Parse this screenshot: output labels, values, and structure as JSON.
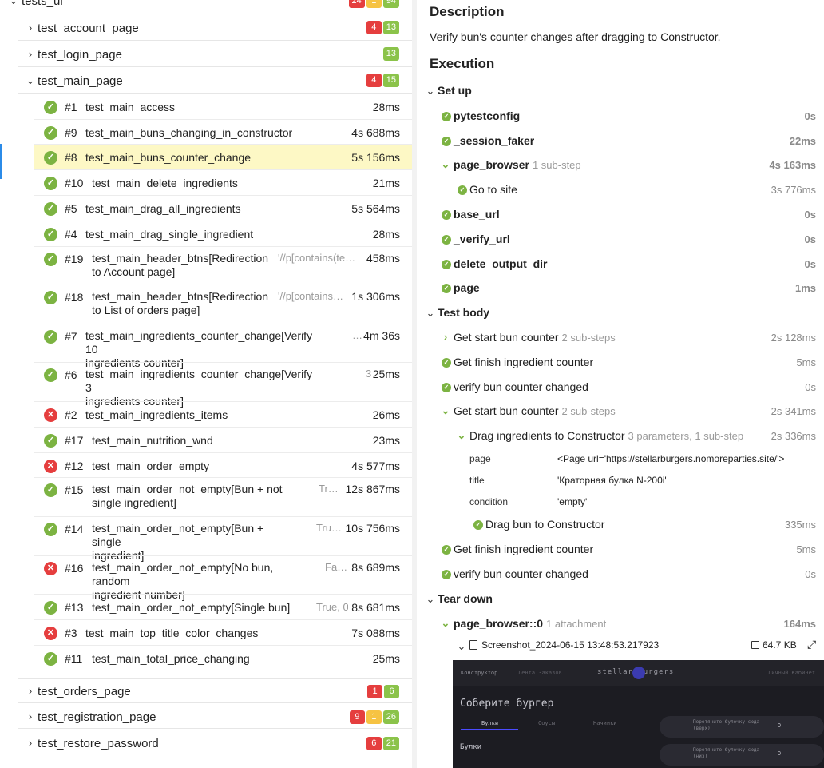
{
  "tree": {
    "root": {
      "label": "tests_ui",
      "badges": [
        "24",
        "1",
        "94"
      ]
    },
    "groups_top": [
      {
        "label": "test_account_page",
        "badges": [
          {
            "v": "4",
            "c": "red"
          },
          {
            "v": "13",
            "c": "grn"
          }
        ]
      },
      {
        "label": "test_login_page",
        "badges": [
          {
            "v": "13",
            "c": "grn"
          }
        ]
      },
      {
        "label": "test_main_page",
        "badges": [
          {
            "v": "4",
            "c": "red"
          },
          {
            "v": "15",
            "c": "grn"
          }
        ]
      }
    ],
    "tests": [
      {
        "num": "#1",
        "name": "test_main_access",
        "name2": "",
        "param": "",
        "dur": "28ms",
        "status": "ok"
      },
      {
        "num": "#9",
        "name": "test_main_buns_changing_in_constructor",
        "name2": "",
        "param": "",
        "dur": "4s 688ms",
        "status": "ok"
      },
      {
        "num": "#8",
        "name": "test_main_buns_counter_change",
        "name2": "",
        "param": "",
        "dur": "5s 156ms",
        "status": "ok"
      },
      {
        "num": "#10",
        "name": "test_main_delete_ingredients",
        "name2": "",
        "param": "",
        "dur": "21ms",
        "status": "ok"
      },
      {
        "num": "#5",
        "name": "test_main_drag_all_ingredients",
        "name2": "",
        "param": "",
        "dur": "5s 564ms",
        "status": "ok"
      },
      {
        "num": "#4",
        "name": "test_main_drag_single_ingredient",
        "name2": "",
        "param": "",
        "dur": "28ms",
        "status": "ok"
      },
      {
        "num": "#19",
        "name": "test_main_header_btns[Redirection",
        "name2": "to Account page]",
        "param": "'//p[contains(te…",
        "dur": "458ms",
        "status": "ok"
      },
      {
        "num": "#18",
        "name": "test_main_header_btns[Redirection",
        "name2": "to List of orders page]",
        "param": "'//p[contains…",
        "dur": "1s 306ms",
        "status": "ok"
      },
      {
        "num": "#7",
        "name": "test_main_ingredients_counter_change[Verify 10",
        "name2": "ingredients counter]",
        "param": "…",
        "dur": "4m 36s",
        "status": "ok"
      },
      {
        "num": "#6",
        "name": "test_main_ingredients_counter_change[Verify 3",
        "name2": "ingredients counter]",
        "param": "3",
        "dur": "25ms",
        "status": "ok"
      },
      {
        "num": "#2",
        "name": "test_main_ingredients_items",
        "name2": "",
        "param": "",
        "dur": "26ms",
        "status": "bad"
      },
      {
        "num": "#17",
        "name": "test_main_nutrition_wnd",
        "name2": "",
        "param": "",
        "dur": "23ms",
        "status": "ok"
      },
      {
        "num": "#12",
        "name": "test_main_order_empty",
        "name2": "",
        "param": "",
        "dur": "4s 577ms",
        "status": "bad"
      },
      {
        "num": "#15",
        "name": "test_main_order_not_empty[Bun + not",
        "name2": "single ingredient]",
        "param": "Tr…",
        "dur": "12s 867ms",
        "status": "ok"
      },
      {
        "num": "#14",
        "name": "test_main_order_not_empty[Bun + single",
        "name2": "ingredient]",
        "param": "Tru…",
        "dur": "10s 756ms",
        "status": "ok"
      },
      {
        "num": "#16",
        "name": "test_main_order_not_empty[No bun, random",
        "name2": "ingredient number]",
        "param": "Fa…",
        "dur": "8s 689ms",
        "status": "bad"
      },
      {
        "num": "#13",
        "name": "test_main_order_not_empty[Single bun]",
        "name2": "",
        "param": "True, 0",
        "dur": "8s 681ms",
        "status": "ok"
      },
      {
        "num": "#3",
        "name": "test_main_top_title_color_changes",
        "name2": "",
        "param": "",
        "dur": "7s 088ms",
        "status": "bad"
      },
      {
        "num": "#11",
        "name": "test_main_total_price_changing",
        "name2": "",
        "param": "",
        "dur": "25ms",
        "status": "ok"
      }
    ],
    "groups_bottom": [
      {
        "label": "test_orders_page",
        "badges": [
          {
            "v": "1",
            "c": "red"
          },
          {
            "v": "6",
            "c": "grn"
          }
        ]
      },
      {
        "label": "test_registration_page",
        "badges": [
          {
            "v": "9",
            "c": "red"
          },
          {
            "v": "1",
            "c": "yel"
          },
          {
            "v": "26",
            "c": "grn"
          }
        ]
      },
      {
        "label": "test_restore_password",
        "badges": [
          {
            "v": "6",
            "c": "red"
          },
          {
            "v": "21",
            "c": "grn"
          }
        ]
      }
    ]
  },
  "detail": {
    "description_title": "Description",
    "description": "Verify bun's counter changes after dragging to Constructor.",
    "execution_title": "Execution",
    "setup": {
      "title": "Set up",
      "steps": [
        {
          "name": "pytestconfig",
          "sub": "",
          "dur": "0s"
        },
        {
          "name": "_session_faker",
          "sub": "",
          "dur": "22ms"
        },
        {
          "name": "page_browser",
          "sub": "1 sub-step",
          "dur": "4s 163ms",
          "child": {
            "name": "Go to site",
            "dur": "3s 776ms"
          }
        },
        {
          "name": "base_url",
          "sub": "",
          "dur": "0s"
        },
        {
          "name": "_verify_url",
          "sub": "",
          "dur": "0s"
        },
        {
          "name": "delete_output_dir",
          "sub": "",
          "dur": "0s"
        },
        {
          "name": "page",
          "sub": "",
          "dur": "1ms"
        }
      ]
    },
    "body": {
      "title": "Test body",
      "steps": [
        {
          "name": "Get start bun counter",
          "sub": "2 sub-steps",
          "dur": "2s 128ms"
        },
        {
          "name": "Get finish ingredient counter",
          "sub": "",
          "dur": "5ms"
        },
        {
          "name": "verify bun counter changed",
          "sub": "",
          "dur": "0s"
        },
        {
          "name": "Get start bun counter",
          "sub": "2 sub-steps",
          "dur": "2s 341ms"
        },
        {
          "name": "Drag ingredients to Constructor",
          "sub": "3 parameters, 1 sub-step",
          "dur": "2s 336ms"
        },
        {
          "name": "Drag bun to Constructor",
          "sub": "",
          "dur": "335ms"
        },
        {
          "name": "Get finish ingredient counter",
          "sub": "",
          "dur": "5ms"
        },
        {
          "name": "verify bun counter changed",
          "sub": "",
          "dur": "0s"
        }
      ],
      "params": [
        {
          "key": "page",
          "value": "<Page url='https://stellarburgers.nomoreparties.site/'>"
        },
        {
          "key": "title",
          "value": "'Краторная булка N-200i'"
        },
        {
          "key": "condition",
          "value": "'empty'"
        }
      ]
    },
    "teardown": {
      "title": "Tear down",
      "step": {
        "name": "page_browser::0",
        "sub": "1 attachment",
        "dur": "164ms"
      },
      "attachment": {
        "name": "Screenshot_2024-06-15 13:48:53.217923",
        "size": "64.7 KB"
      }
    },
    "screenshot": {
      "nav1": "Конструктор",
      "nav2": "Лента Заказов",
      "logo": "stellar burgers",
      "account": "Личный Кабинет",
      "heading": "Соберите бургер",
      "tab1": "Булки",
      "tab2": "Соусы",
      "tab3": "Начинки",
      "section": "Булки",
      "item1": "Перетяните булочку сюда (верх)",
      "item2": "Перетяните булочку сюда (низ)",
      "price": "0"
    }
  }
}
